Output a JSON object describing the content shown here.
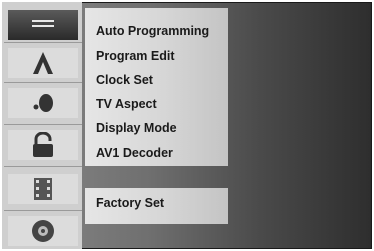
{
  "menu": {
    "items": [
      {
        "label": "Auto Programming"
      },
      {
        "label": "Program Edit"
      },
      {
        "label": "Clock Set"
      },
      {
        "label": "TV Aspect"
      },
      {
        "label": "Display Mode"
      },
      {
        "label": "AV1 Decoder"
      }
    ],
    "extra_items": [
      {
        "label": "Factory Set"
      }
    ]
  },
  "sidebar": {
    "icons": [
      {
        "name": "general-settings-icon",
        "active": true
      },
      {
        "name": "language-icon",
        "active": false
      },
      {
        "name": "audio-icon",
        "active": false
      },
      {
        "name": "lock-icon",
        "active": false
      },
      {
        "name": "recording-icon",
        "active": false
      },
      {
        "name": "disc-icon",
        "active": false
      }
    ]
  },
  "colors": {
    "menu_background": "#dcdcdc",
    "menu_text": "#1a1a1a",
    "active_icon_background": "#3a3a3a"
  }
}
